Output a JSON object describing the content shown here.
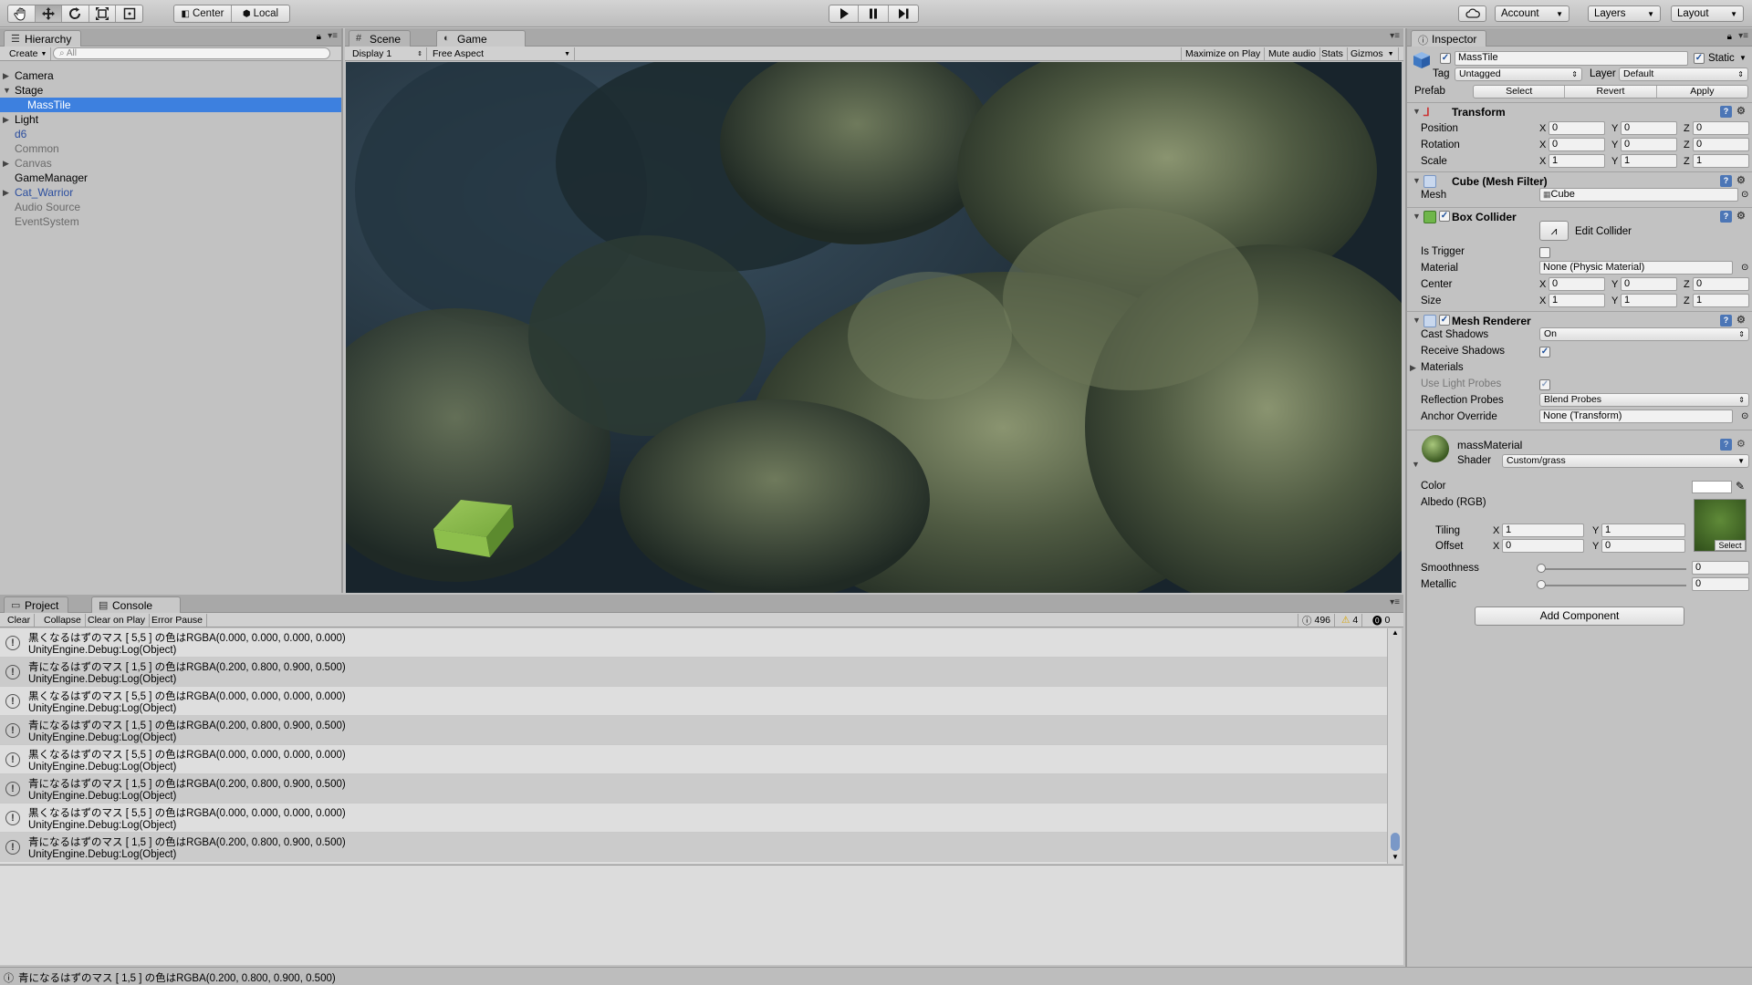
{
  "toolbar": {
    "pivot_center": "Center",
    "pivot_local": "Local",
    "account": "Account",
    "layers": "Layers",
    "layout": "Layout"
  },
  "hierarchy": {
    "tab": "Hierarchy",
    "create": "Create",
    "search_placeholder": "All",
    "items": [
      {
        "label": "Camera"
      },
      {
        "label": "Stage"
      },
      {
        "label": "MassTile"
      },
      {
        "label": "Light"
      },
      {
        "label": "d6"
      },
      {
        "label": "Common"
      },
      {
        "label": "Canvas"
      },
      {
        "label": "GameManager"
      },
      {
        "label": "Cat_Warrior"
      },
      {
        "label": "Audio Source"
      },
      {
        "label": "EventSystem"
      }
    ]
  },
  "viewport": {
    "tab_scene": "Scene",
    "tab_game": "Game",
    "display": "Display 1",
    "aspect": "Free Aspect",
    "maximize": "Maximize on Play",
    "mute": "Mute audio",
    "stats": "Stats",
    "gizmos": "Gizmos"
  },
  "console": {
    "tab_project": "Project",
    "tab_console": "Console",
    "clear": "Clear",
    "collapse": "Collapse",
    "clear_on_play": "Clear on Play",
    "error_pause": "Error Pause",
    "count_log": "496",
    "count_warn": "4",
    "count_error": "0",
    "rows": [
      {
        "msg": "黒くなるはずのマス [ 5,5 ] の色はRGBA(0.000, 0.000, 0.000, 0.000)",
        "trace": "UnityEngine.Debug:Log(Object)"
      },
      {
        "msg": "青になるはずのマス [ 1,5 ] の色はRGBA(0.200, 0.800, 0.900, 0.500)",
        "trace": "UnityEngine.Debug:Log(Object)"
      },
      {
        "msg": "黒くなるはずのマス [ 5,5 ] の色はRGBA(0.000, 0.000, 0.000, 0.000)",
        "trace": "UnityEngine.Debug:Log(Object)"
      },
      {
        "msg": "青になるはずのマス [ 1,5 ] の色はRGBA(0.200, 0.800, 0.900, 0.500)",
        "trace": "UnityEngine.Debug:Log(Object)"
      },
      {
        "msg": "黒くなるはずのマス [ 5,5 ] の色はRGBA(0.000, 0.000, 0.000, 0.000)",
        "trace": "UnityEngine.Debug:Log(Object)"
      },
      {
        "msg": "青になるはずのマス [ 1,5 ] の色はRGBA(0.200, 0.800, 0.900, 0.500)",
        "trace": "UnityEngine.Debug:Log(Object)"
      },
      {
        "msg": "黒くなるはずのマス [ 5,5 ] の色はRGBA(0.000, 0.000, 0.000, 0.000)",
        "trace": "UnityEngine.Debug:Log(Object)"
      },
      {
        "msg": "青になるはずのマス [ 1,5 ] の色はRGBA(0.200, 0.800, 0.900, 0.500)",
        "trace": "UnityEngine.Debug:Log(Object)"
      }
    ]
  },
  "status": {
    "message": "青になるはずのマス [ 1,5 ] の色はRGBA(0.200, 0.800, 0.900, 0.500)"
  },
  "inspector": {
    "tab": "Inspector",
    "object_name": "MassTile",
    "static_label": "Static",
    "tag_label": "Tag",
    "tag_value": "Untagged",
    "layer_label": "Layer",
    "layer_value": "Default",
    "prefab_label": "Prefab",
    "prefab_select": "Select",
    "prefab_revert": "Revert",
    "prefab_apply": "Apply",
    "transform": {
      "title": "Transform",
      "position_label": "Position",
      "rotation_label": "Rotation",
      "scale_label": "Scale",
      "position": [
        "0",
        "0",
        "0"
      ],
      "rotation": [
        "0",
        "0",
        "0"
      ],
      "scale": [
        "1",
        "1",
        "1"
      ]
    },
    "mesh_filter": {
      "title": "Cube (Mesh Filter)",
      "mesh_label": "Mesh",
      "mesh_value": "Cube"
    },
    "box_collider": {
      "title": "Box Collider",
      "edit_collider": "Edit Collider",
      "is_trigger": "Is Trigger",
      "material_label": "Material",
      "material_value": "None (Physic Material)",
      "center_label": "Center",
      "size_label": "Size",
      "center": [
        "0",
        "0",
        "0"
      ],
      "size": [
        "1",
        "1",
        "1"
      ]
    },
    "mesh_renderer": {
      "title": "Mesh Renderer",
      "cast_shadows_label": "Cast Shadows",
      "cast_shadows_value": "On",
      "receive_shadows_label": "Receive Shadows",
      "materials_label": "Materials",
      "light_probes_label": "Use Light Probes",
      "reflection_label": "Reflection Probes",
      "reflection_value": "Blend Probes",
      "anchor_label": "Anchor Override",
      "anchor_value": "None (Transform)"
    },
    "material": {
      "name": "massMaterial",
      "shader_label": "Shader",
      "shader_value": "Custom/grass",
      "color_label": "Color",
      "albedo_label": "Albedo (RGB)",
      "tiling_label": "Tiling",
      "offset_label": "Offset",
      "tiling": [
        "1",
        "1"
      ],
      "offset": [
        "0",
        "0"
      ],
      "select_label": "Select",
      "smoothness_label": "Smoothness",
      "smoothness_value": "0",
      "metallic_label": "Metallic",
      "metallic_value": "0"
    },
    "add_component": "Add Component"
  }
}
